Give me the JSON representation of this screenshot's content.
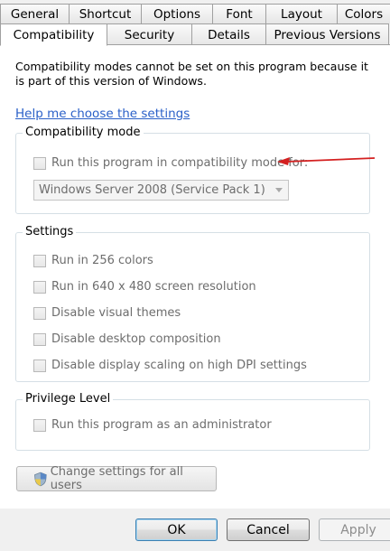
{
  "tabs": {
    "top_row": [
      "General",
      "Shortcut",
      "Options",
      "Font",
      "Layout",
      "Colors"
    ],
    "bottom_row": [
      "Compatibility",
      "Security",
      "Details",
      "Previous Versions"
    ],
    "active": "Compatibility"
  },
  "notice": "Compatibility modes cannot be set on this program because it is part of this version of Windows.",
  "help_link": "Help me choose the settings",
  "compatibility_mode": {
    "legend": "Compatibility mode",
    "checkbox_label": "Run this program in compatibility mode for:",
    "checked": false,
    "dropdown_value": "Windows Server 2008 (Service Pack 1)"
  },
  "settings": {
    "legend": "Settings",
    "items": [
      {
        "label": "Run in 256 colors",
        "checked": false
      },
      {
        "label": "Run in 640 x 480 screen resolution",
        "checked": false
      },
      {
        "label": "Disable visual themes",
        "checked": false
      },
      {
        "label": "Disable desktop composition",
        "checked": false
      },
      {
        "label": "Disable display scaling on high DPI settings",
        "checked": false
      }
    ]
  },
  "privilege": {
    "legend": "Privilege Level",
    "checkbox_label": "Run this program as an administrator",
    "checked": false
  },
  "change_settings_button": "Change settings for all users",
  "buttons": {
    "ok": "OK",
    "cancel": "Cancel",
    "apply": "Apply"
  },
  "colors": {
    "link": "#2a60c8",
    "annotation_arrow": "#d42020",
    "disabled_text": "#6d6d6d"
  },
  "icons": {
    "shield": "uac-shield-icon",
    "arrow": "red-annotation-arrow"
  }
}
